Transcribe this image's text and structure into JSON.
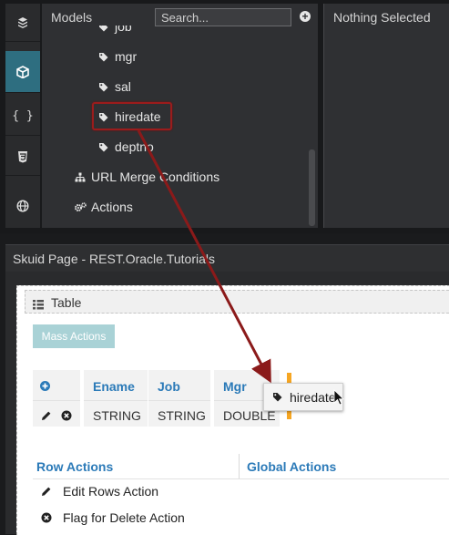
{
  "models_panel": {
    "title": "Models",
    "search_placeholder": "Search...",
    "tree": [
      {
        "label": "job",
        "kind": "field"
      },
      {
        "label": "mgr",
        "kind": "field"
      },
      {
        "label": "sal",
        "kind": "field"
      },
      {
        "label": "hiredate",
        "kind": "field",
        "highlighted": true
      },
      {
        "label": "deptno",
        "kind": "field"
      },
      {
        "label": "URL Merge Conditions",
        "kind": "sitemap"
      },
      {
        "label": "Actions",
        "kind": "gears"
      }
    ]
  },
  "rail": [
    "cube-stack-icon",
    "cube-icon",
    "braces-icon",
    "css3-icon",
    "globe-icon"
  ],
  "properties_panel": {
    "title": "Nothing Selected"
  },
  "page": {
    "title": "Skuid Page - REST.Oracle.Tutorials",
    "table_label": "Table",
    "mass_actions_label": "Mass Actions",
    "columns": [
      {
        "header": "Ename",
        "type": "STRING"
      },
      {
        "header": "Job",
        "type": "STRING"
      },
      {
        "header": "Mgr",
        "type": "DOUBLE"
      }
    ],
    "drag_ghost_label": "hiredate",
    "row_actions_heading": "Row Actions",
    "global_actions_heading": "Global Actions",
    "row_actions": [
      {
        "label": "Edit Rows Action",
        "icon": "pencil-icon"
      },
      {
        "label": "Flag for Delete Action",
        "icon": "x-circle-icon"
      }
    ]
  },
  "colors": {
    "accent_teal": "#2e6e80",
    "link_blue": "#2b7ab8",
    "highlight_red": "#9b1c1c",
    "drop_marker_orange": "#f6a623",
    "mass_actions_bg": "#a9d2d6"
  }
}
